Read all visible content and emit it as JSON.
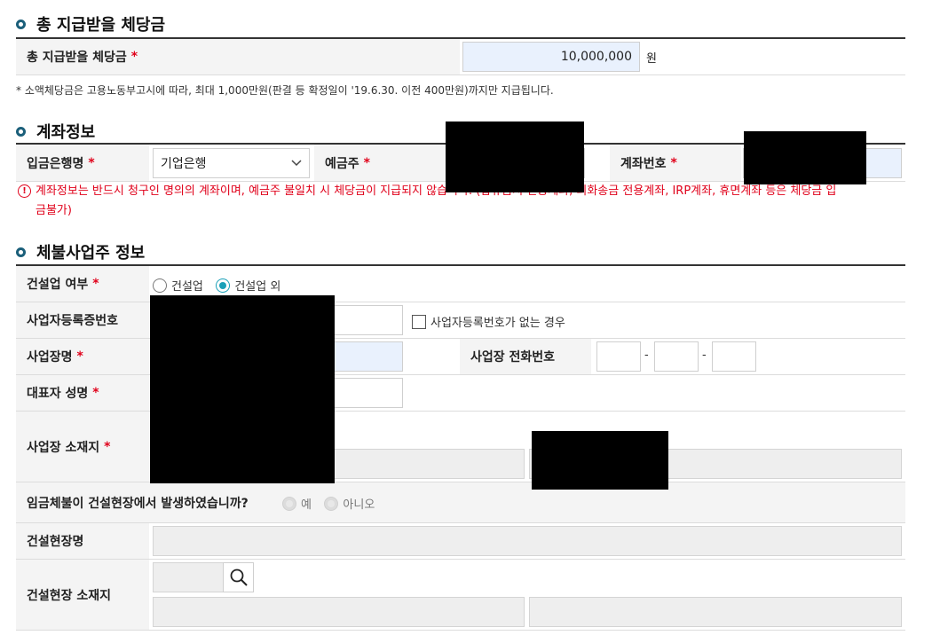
{
  "sections": {
    "total": {
      "title": "총 지급받을 체당금"
    },
    "account": {
      "title": "계좌정보"
    },
    "employer": {
      "title": "체불사업주 정보"
    }
  },
  "total": {
    "label": "총 지급받을 체당금",
    "required": "*",
    "amount": "10,000,000",
    "unit": "원",
    "note": "* 소액체당금은 고용노동부고시에 따라, 최대 1,000만원(판결 등 확정일이 '19.6.30. 이전 400만원)까지만 지급됩니다."
  },
  "account": {
    "bank_label": "입금은행명",
    "bank_value": "기업은행",
    "holder_label": "예금주",
    "number_label": "계좌번호",
    "required": "*",
    "warning_icon": "!",
    "warning_line1": "계좌정보는 반드시 청구인 명의의 계좌이며, 예금주 불일치 시 체당금이 지급되지 않습니다. (압류금지 전용계좌, 외화송금 전용계좌, IRP계좌, 휴면계좌 등은 체당금 입",
    "warning_line2": "금불가)"
  },
  "employer": {
    "required": "*",
    "construction_label": "건설업 여부",
    "construction_options": [
      "건설업",
      "건설업 외"
    ],
    "construction_selected": "건설업 외",
    "biz_no_label": "사업자등록증번호",
    "no_biz_no_label": "사업자등록번호가 없는 경우",
    "biz_name_label": "사업장명",
    "biz_phone_label": "사업장 전화번호",
    "phone_sep": "-",
    "rep_label": "대표자 성명",
    "address_label": "사업장 소재지",
    "site_question": "임금체불이 건설현장에서 발생하였습니까?",
    "site_options": [
      "예",
      "아니오"
    ],
    "site_name_label": "건설현장명",
    "site_address_label": "건설현장 소재지"
  },
  "colors": {
    "accent": "#1b5f7a",
    "required": "#e0001a",
    "radio_selected": "#1aa0b8",
    "input_blue": "#e9f1fd"
  }
}
